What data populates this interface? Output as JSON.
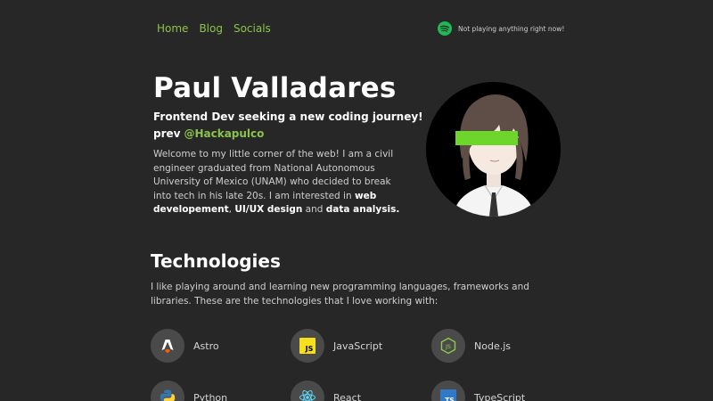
{
  "nav": {
    "items": [
      "Home",
      "Blog",
      "Socials"
    ]
  },
  "spotify": {
    "status": "Not playing anything right now!",
    "icon": "spotify-icon",
    "color": "#1db954"
  },
  "hero": {
    "name": "Paul Valladares",
    "tagline": "Frontend Dev seeking a new coding journey!",
    "prev_label": "prev",
    "prev_handle": "@Hackapulco",
    "intro_text": "Welcome to my little corner of the web! I am a civil engineer graduated from National Autonomous University of Mexico (UNAM) who decided to break into tech in his late 20s. I am interested in ",
    "interest_1": "web developement",
    "sep_1": ", ",
    "interest_2": "UI/UX design",
    "sep_2": " and ",
    "interest_3": "data analysis.",
    "avatar": "anime-avatar"
  },
  "technologies": {
    "title": "Technologies",
    "description": "I like playing around and learning new programming languages, frameworks and libraries. These are the technologies that I love working with:",
    "items": [
      {
        "label": "Astro",
        "icon": "astro-icon"
      },
      {
        "label": "JavaScript",
        "icon": "javascript-icon"
      },
      {
        "label": "Node.js",
        "icon": "nodejs-icon"
      },
      {
        "label": "Python",
        "icon": "python-icon"
      },
      {
        "label": "React",
        "icon": "react-icon"
      },
      {
        "label": "TypeScript",
        "icon": "typescript-icon"
      }
    ]
  },
  "colors": {
    "background": "#272727",
    "accent": "#8bc34a",
    "icon_bg": "#4a4a4a"
  }
}
